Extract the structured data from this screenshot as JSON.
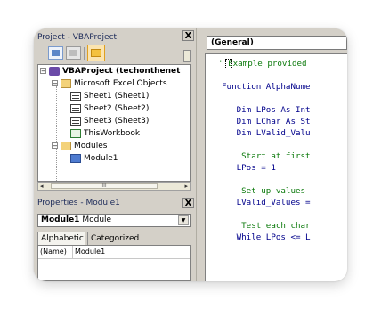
{
  "project_pane": {
    "title": "Project - VBAProject",
    "close": "X",
    "tree": {
      "root": "VBAProject (techonthenet",
      "excel_objects": "Microsoft Excel Objects",
      "sheets": [
        "Sheet1 (Sheet1)",
        "Sheet2 (Sheet2)",
        "Sheet3 (Sheet3)"
      ],
      "workbook": "ThisWorkbook",
      "modules": "Modules",
      "module": "Module1",
      "collapse": "−"
    },
    "hscroll": {
      "left": "◂",
      "right": "▸",
      "thumb": "III"
    }
  },
  "properties_pane": {
    "title": "Properties - Module1",
    "close": "X",
    "object_name": "Module1",
    "object_type": "Module",
    "dropdown": "▼",
    "tabs": [
      "Alphabetic",
      "Categorized"
    ],
    "rows": [
      {
        "key": "(Name)",
        "value": "Module1"
      }
    ]
  },
  "code_window": {
    "object_combo": "(General)",
    "lines": [
      "' Example provided",
      "",
      "Function AlphaNume",
      "",
      "   Dim LPos As Int",
      "   Dim LChar As St",
      "   Dim LValid_Valu",
      "",
      "   'Start at first",
      "   LPos = 1",
      "",
      "   'Set up values",
      "   LValid_Values =",
      "",
      "   'Test each char",
      "   While LPos <= L"
    ]
  },
  "colors": {
    "chrome": "#d4d0c8",
    "comment": "#0c7a0c",
    "keyword": "#00008b",
    "title": "#1c2a59"
  }
}
